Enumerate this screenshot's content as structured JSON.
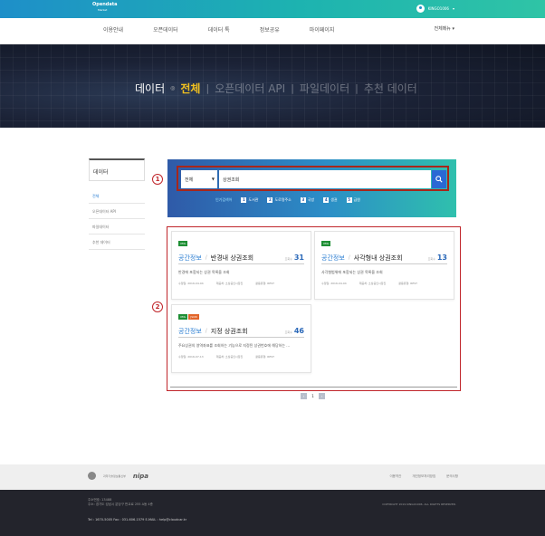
{
  "header": {
    "logo_title": "Opendata",
    "logo_sub": "Market",
    "username": "KINGO1006",
    "caret": "▾"
  },
  "gnb": {
    "menu": [
      "이용안내",
      "오픈데이터",
      "데이터 톡",
      "정보공유",
      "마이페이지"
    ],
    "all_menu": "전체메뉴 ▾"
  },
  "hero": {
    "first": "데이터",
    "active": "전체",
    "items": [
      "오픈데이터 API",
      "파일데이터",
      "추천 데이터"
    ]
  },
  "sidebar": {
    "title": "데이터",
    "items": [
      "전체",
      "오픈데이터 API",
      "파일데이터",
      "추천 데이터"
    ]
  },
  "search": {
    "select_value": "전체",
    "query": "상권조회",
    "popular_label": "인기검색어",
    "keywords": [
      {
        "n": "1",
        "text": "도서관"
      },
      {
        "n": "2",
        "text": "도로명주소"
      },
      {
        "n": "3",
        "text": "국방"
      },
      {
        "n": "4",
        "text": "생권"
      },
      {
        "n": "5",
        "text": "급원"
      }
    ]
  },
  "markers": {
    "m1": "1",
    "m2": "2"
  },
  "results": [
    {
      "badges": [
        "XML"
      ],
      "category": "공간정보",
      "name": "반경내 상권조회",
      "views_label": "조회수",
      "views": "31",
      "desc": "반경에 포함되는 상권 목록을 조회",
      "date": "수정일: 2016-04-04",
      "provider": "제공처: 소상공인시장진",
      "download": "활용유형: REST"
    },
    {
      "badges": [
        "XML"
      ],
      "category": "공간정보",
      "name": "사각형내 상권조회",
      "views_label": "조회수",
      "views": "13",
      "desc": "사각형범위에 포함되는 상권 목록을 조회",
      "date": "수정일: 2016-04-04",
      "provider": "제공처: 소상공인시장진",
      "download": "활용유형: REST"
    },
    {
      "badges": [
        "XML",
        "JSON"
      ],
      "category": "공간정보",
      "name": "지정 상권조회",
      "views_label": "조회수",
      "views": "46",
      "desc": "주요상권의 영역좌표를 조회하는 기능으로 지정된 상권번호에 해당하는 ...",
      "date": "수정일: 2016-07-13",
      "provider": "제공처: 소상공인시장진",
      "download": "활용유형: REST"
    }
  ],
  "pagination": {
    "prev": "‹",
    "current": "1",
    "next": "›"
  },
  "footer": {
    "org": "과학기술정보통신부",
    "brand": "nipa",
    "links": [
      "이용약관",
      "개인정보처리방침",
      "문의사항"
    ],
    "addr1": "주소번호: 13488",
    "addr2": "주소: 경기도 성남시 분당구 판교로 255 A동 4층",
    "tel": "Tel : 1670-5005  Fax : 031-606-1579  E-MAIL : help@cloudcar.kr",
    "copyright": "COPYRIGHT 2019 KINGO1006. ALL RIGHTS RESERVED."
  }
}
